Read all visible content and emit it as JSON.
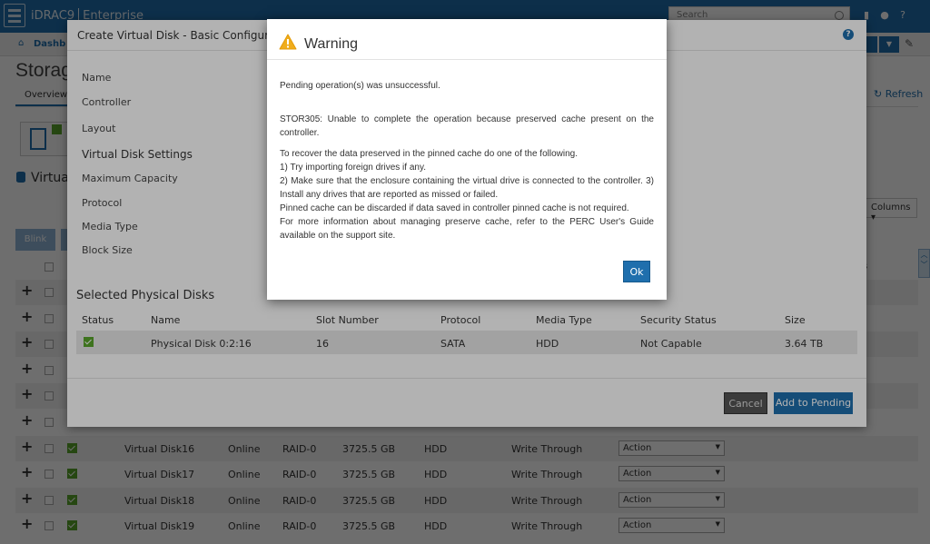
{
  "app": {
    "brand": "iDRAC9",
    "edition": "Enterprise",
    "search_placeholder": "Search"
  },
  "breadcrumb": {
    "label": "Dashb"
  },
  "page": {
    "title": "Storag",
    "tab_overview": "Overview",
    "refresh": "Refresh",
    "section_title": "Virtual",
    "blink_button": "Blink",
    "columns_button": "Columns",
    "scroll_indicator": "s"
  },
  "virtual_disks": [
    {
      "name": "",
      "status": "",
      "layout": "",
      "capacity": "",
      "media": "",
      "policy": "",
      "action": ""
    },
    {
      "name": "",
      "status": "",
      "layout": "",
      "capacity": "",
      "media": "",
      "policy": "",
      "action": ""
    },
    {
      "name": "",
      "status": "",
      "layout": "",
      "capacity": "",
      "media": "",
      "policy": "",
      "action": ""
    },
    {
      "name": "",
      "status": "",
      "layout": "",
      "capacity": "",
      "media": "",
      "policy": "",
      "action": ""
    },
    {
      "name": "",
      "status": "",
      "layout": "",
      "capacity": "",
      "media": "",
      "policy": "",
      "action": ""
    },
    {
      "name": "",
      "status": "",
      "layout": "",
      "capacity": "",
      "media": "",
      "policy": "",
      "action": ""
    },
    {
      "name": "Virtual Disk16",
      "status": "Online",
      "layout": "RAID-0",
      "capacity": "3725.5 GB",
      "media": "HDD",
      "policy": "Write Through",
      "action": "Action"
    },
    {
      "name": "Virtual Disk17",
      "status": "Online",
      "layout": "RAID-0",
      "capacity": "3725.5 GB",
      "media": "HDD",
      "policy": "Write Through",
      "action": "Action"
    },
    {
      "name": "Virtual Disk18",
      "status": "Online",
      "layout": "RAID-0",
      "capacity": "3725.5 GB",
      "media": "HDD",
      "policy": "Write Through",
      "action": "Action"
    },
    {
      "name": "Virtual Disk19",
      "status": "Online",
      "layout": "RAID-0",
      "capacity": "3725.5 GB",
      "media": "HDD",
      "policy": "Write Through",
      "action": "Action"
    }
  ],
  "create_dialog": {
    "title": "Create Virtual Disk - Basic Configuration",
    "labels": {
      "name": "Name",
      "controller": "Controller",
      "layout": "Layout",
      "vd_settings": "Virtual Disk Settings",
      "max_capacity": "Maximum Capacity",
      "protocol": "Protocol",
      "media_type": "Media Type",
      "block_size": "Block Size"
    },
    "selected_title": "Selected Physical Disks",
    "columns": {
      "status": "Status",
      "name": "Name",
      "slot": "Slot Number",
      "protocol": "Protocol",
      "media": "Media Type",
      "security": "Security Status",
      "size": "Size"
    },
    "disk": {
      "name": "Physical Disk 0:2:16",
      "slot": "16",
      "protocol": "SATA",
      "media": "HDD",
      "security": "Not Capable",
      "size": "3.64 TB"
    },
    "cancel": "Cancel",
    "add": "Add to Pending"
  },
  "warning": {
    "title": "Warning",
    "line1": "Pending operation(s) was unsuccessful.",
    "line2": "STOR305: Unable to complete the operation because preserved cache present on the controller.",
    "line3": "To recover the data preserved in the pinned cache do one of the following.",
    "line4": "1) Try importing foreign drives if any.",
    "line5": "2) Make sure that the enclosure containing the virtual drive is connected to the controller. 3) Install any drives that are reported as missed or failed.",
    "line6": "Pinned cache can be discarded if data saved in controller pinned cache is not required.",
    "line7": "For more information about managing preserve cache, refer to the PERC User's Guide available on the support site.",
    "ok": "Ok",
    "colors": {
      "accent": "#1f6fad",
      "warn": "#f0ad1c"
    }
  }
}
